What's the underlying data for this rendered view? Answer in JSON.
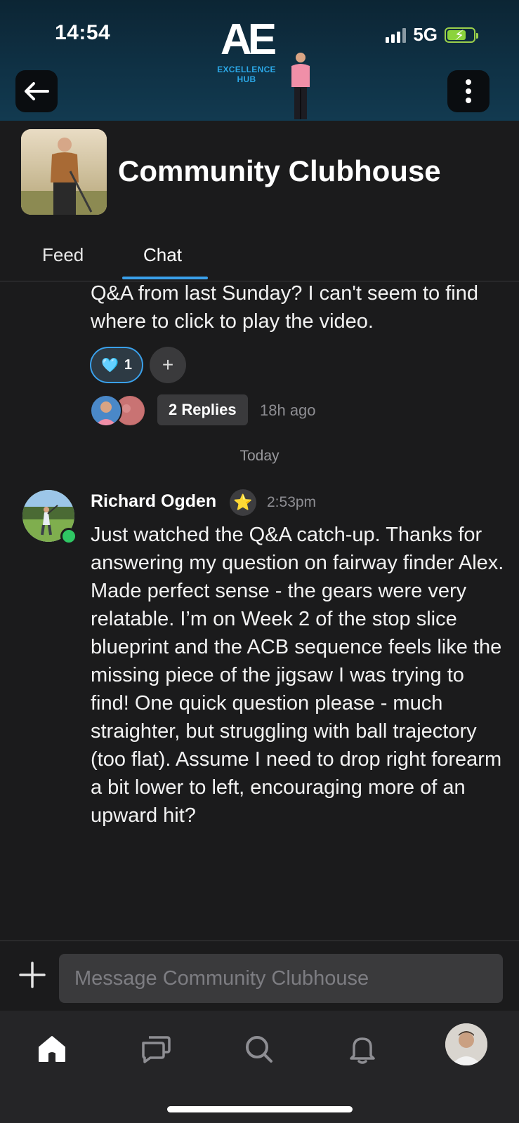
{
  "status_bar": {
    "time": "14:54",
    "network": "5G"
  },
  "header": {
    "logo_mark": "AE",
    "logo_sub": "EXCELLENCE HUB"
  },
  "group": {
    "title": "Community Clubhouse"
  },
  "tabs": [
    {
      "label": "Feed"
    },
    {
      "label": "Chat",
      "active": true
    }
  ],
  "previous_message": {
    "text": "Q&A from last Sunday? I can't seem to find where to click to play the video.",
    "reaction": {
      "emoji": "🩵",
      "count": "1"
    },
    "add_reaction": "+",
    "replies_label": "2 Replies",
    "replies_time": "18h ago"
  },
  "day_separator": "Today",
  "message": {
    "author": "Richard Ogden",
    "badge": "⭐",
    "time": "2:53pm",
    "text": "Just watched the Q&A catch-up. Thanks for answering my question on fairway finder Alex. Made perfect sense - the gears were very relatable. I’m on Week 2 of the stop slice blueprint and the ACB sequence feels like the missing piece of the jigsaw I was trying to find! One quick question please - much straighter, but struggling with ball trajectory (too flat). Assume I need to drop right forearm a bit lower to left, encouraging more of an upward hit?"
  },
  "composer": {
    "placeholder": "Message Community Clubhouse"
  },
  "tabbar": {
    "items": [
      {
        "icon": "home-icon",
        "active": true
      },
      {
        "icon": "chat-bubbles-icon"
      },
      {
        "icon": "search-icon"
      },
      {
        "icon": "bell-icon"
      },
      {
        "icon": "profile-avatar"
      }
    ]
  },
  "colors": {
    "accent": "#3aa0ea",
    "online": "#2fc764",
    "background": "#1b1b1c",
    "header": "#0f3246"
  }
}
